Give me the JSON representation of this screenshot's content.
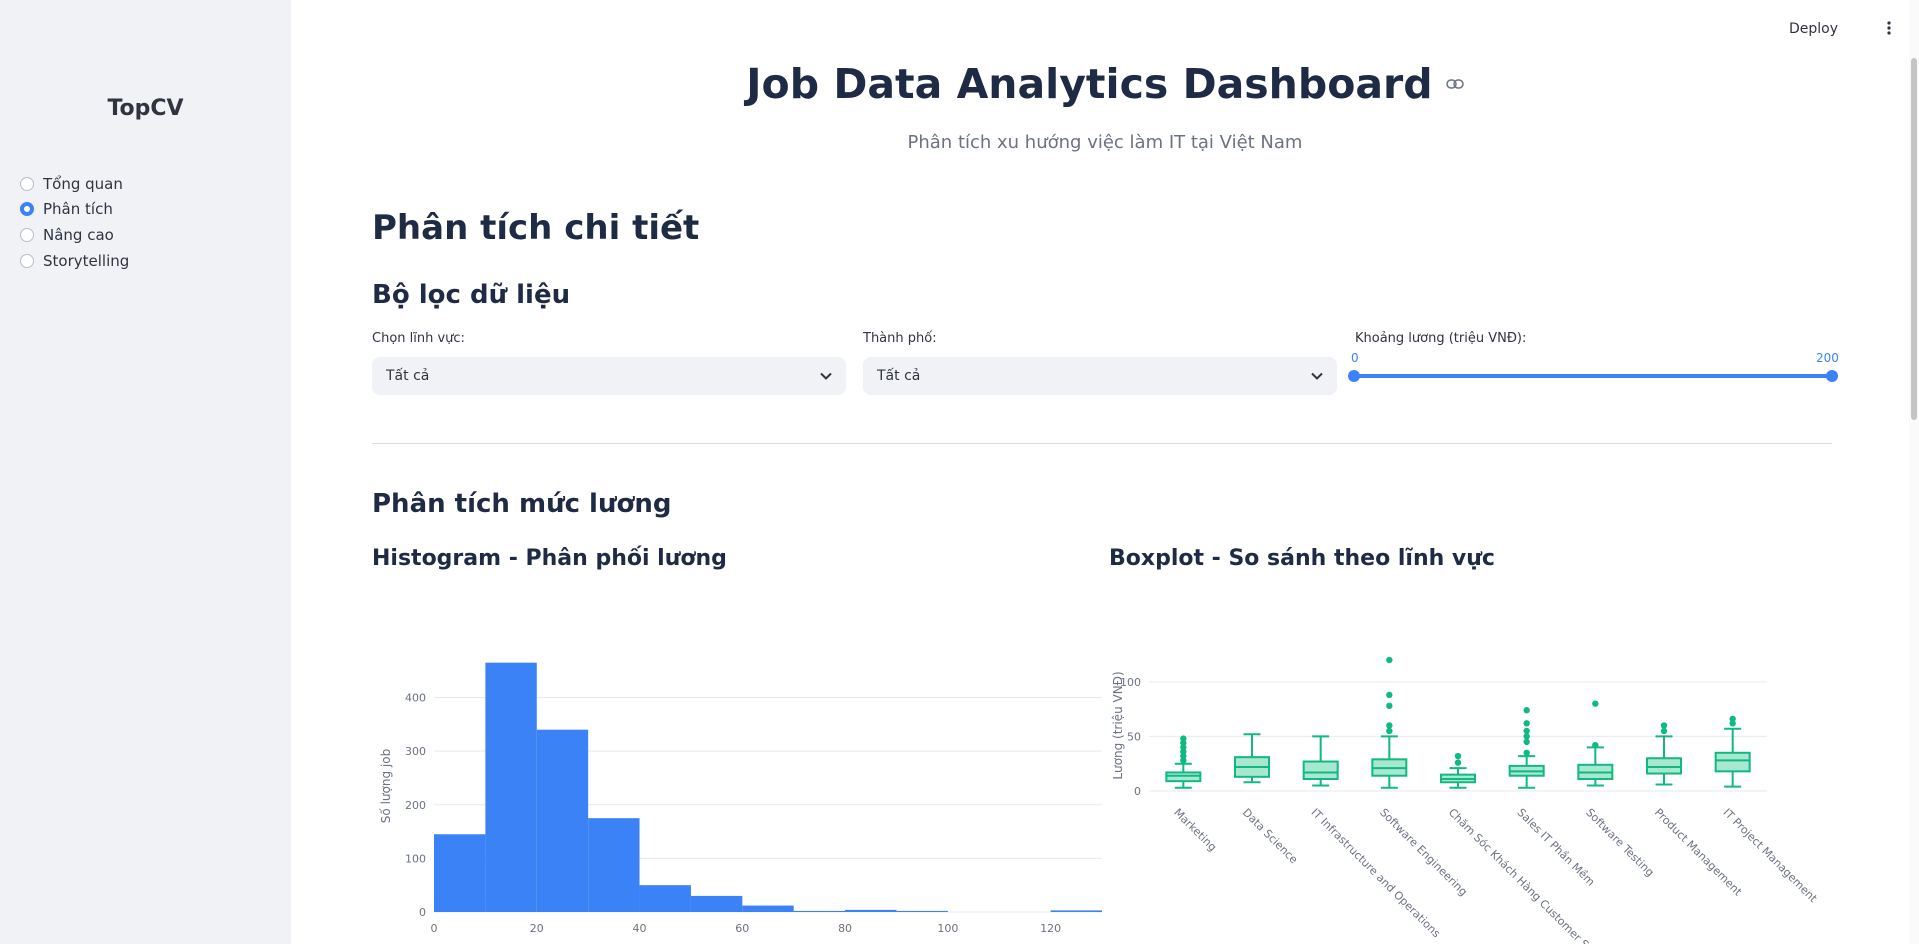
{
  "sidebar": {
    "title": "TopCV",
    "nav": [
      {
        "label": "Tổng quan",
        "selected": false
      },
      {
        "label": "Phân tích",
        "selected": true
      },
      {
        "label": "Nâng cao",
        "selected": false
      },
      {
        "label": "Storytelling",
        "selected": false
      }
    ]
  },
  "topbar": {
    "deploy_label": "Deploy",
    "menu_icon": "vertical-dots-icon"
  },
  "header": {
    "title": "Job Data Analytics Dashboard",
    "subtitle": "Phân tích xu hướng việc làm IT tại Việt Nam"
  },
  "page": {
    "section_title": "Phân tích chi tiết"
  },
  "filters": {
    "title": "Bộ lọc dữ liệu",
    "field_label": "Chọn lĩnh vực:",
    "field_value": "Tất cả",
    "city_label": "Thành phố:",
    "city_value": "Tất cả",
    "salary_label": "Khoảng lương (triệu VNĐ):",
    "salary_min": 0,
    "salary_max": 200,
    "salary_range": [
      0,
      200
    ]
  },
  "salary_section": {
    "title": "Phân tích mức lương",
    "hist_title": "Histogram - Phân phối lương",
    "box_title": "Boxplot - So sánh theo lĩnh vực"
  },
  "colors": {
    "accent": "#3b82f6",
    "box": "#10b981",
    "box_fill": "#a7e8cf"
  },
  "chart_data": [
    {
      "type": "bar",
      "title": "",
      "ylabel": "Số lượng job",
      "xlabel": "",
      "bins": [
        [
          0,
          10
        ],
        [
          10,
          20
        ],
        [
          20,
          30
        ],
        [
          30,
          40
        ],
        [
          40,
          50
        ],
        [
          50,
          60
        ],
        [
          60,
          70
        ],
        [
          70,
          80
        ],
        [
          80,
          90
        ],
        [
          90,
          100
        ],
        [
          100,
          110
        ],
        [
          110,
          120
        ],
        [
          120,
          130
        ]
      ],
      "values": [
        145,
        465,
        340,
        175,
        50,
        30,
        12,
        2,
        4,
        2,
        0,
        0,
        3
      ],
      "xlim": [
        0,
        130
      ],
      "ylim": [
        0,
        470
      ],
      "xticks": [
        0,
        20,
        40,
        60,
        80,
        100,
        120
      ],
      "yticks": [
        0,
        100,
        200,
        300,
        400
      ],
      "grid": true
    },
    {
      "type": "box",
      "title": "",
      "ylabel": "Lương (triệu VNĐ)",
      "xlabel": "",
      "ylim": [
        0,
        120
      ],
      "yticks": [
        0,
        50,
        100
      ],
      "grid": true,
      "categories": [
        "Marketing",
        "Data Science",
        "IT Infrastructure and Operations",
        "Software Engineering",
        "Chăm Sóc Khách Hàng Customer Service",
        "Sales IT Phần Mềm",
        "Software Testing",
        "Product Management",
        "IT Project Management"
      ],
      "boxes": [
        {
          "min": 3,
          "q1": 9,
          "median": 14,
          "q3": 17,
          "max": 25,
          "outliers": [
            28,
            32,
            36,
            40,
            44,
            48
          ]
        },
        {
          "min": 8,
          "q1": 13,
          "median": 22,
          "q3": 31,
          "max": 52,
          "outliers": []
        },
        {
          "min": 5,
          "q1": 11,
          "median": 17,
          "q3": 27,
          "max": 50,
          "outliers": []
        },
        {
          "min": 3,
          "q1": 14,
          "median": 21,
          "q3": 29,
          "max": 50,
          "outliers": [
            55,
            60,
            78,
            88,
            120
          ]
        },
        {
          "min": 3,
          "q1": 8,
          "median": 11,
          "q3": 15,
          "max": 21,
          "outliers": [
            26,
            32
          ]
        },
        {
          "min": 3,
          "q1": 14,
          "median": 18,
          "q3": 23,
          "max": 32,
          "outliers": [
            35,
            45,
            50,
            55,
            62,
            74
          ]
        },
        {
          "min": 5,
          "q1": 11,
          "median": 17,
          "q3": 24,
          "max": 40,
          "outliers": [
            42,
            80
          ]
        },
        {
          "min": 6,
          "q1": 16,
          "median": 22,
          "q3": 30,
          "max": 50,
          "outliers": [
            55,
            60
          ]
        },
        {
          "min": 4,
          "q1": 18,
          "median": 28,
          "q3": 35,
          "max": 57,
          "outliers": [
            62,
            66
          ]
        }
      ]
    }
  ]
}
